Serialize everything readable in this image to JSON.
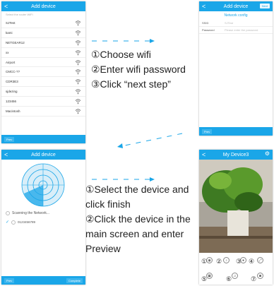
{
  "screen1": {
    "title": "Add device",
    "back": "<",
    "hint": "Select the router WiFi",
    "networks": [
      "SJTest",
      "kami",
      "NETGEAR12",
      "xx",
      "Airport",
      "CMCC-??",
      "CDR3E3",
      "sjdezing",
      "123456",
      "Macintosh"
    ],
    "footer_btn": "Prev"
  },
  "screen2": {
    "title": "Add device",
    "back": "<",
    "next": "Next",
    "section_title": "Network config",
    "ssid_label": "SSID",
    "ssid_value": "SJTest",
    "password_label": "Password",
    "password_placeholder": "Please enter the password",
    "footer_btn": "Prev"
  },
  "screen3": {
    "title": "Add device",
    "back": "<",
    "scanning": "Scanning the Network...",
    "device_id": "0123456789",
    "footer_prev": "Prev",
    "footer_complete": "Complete"
  },
  "screen4": {
    "title": "My Device3",
    "back": "<",
    "row1_numbers": [
      "①",
      "②",
      "③",
      "④"
    ],
    "row2_numbers": [
      "⑤",
      "⑥",
      "⑦"
    ]
  },
  "instructions_top": [
    "①Choose wifi",
    "②Enter wifi password",
    "③Click “next step”"
  ],
  "instructions_bottom": [
    "①Select the device and",
    "click finish",
    "②Click the device in the",
    "main screen and enter",
    "Preview"
  ],
  "colors": {
    "accent": "#1aa6e8",
    "arrow": "#1aa6e8"
  }
}
